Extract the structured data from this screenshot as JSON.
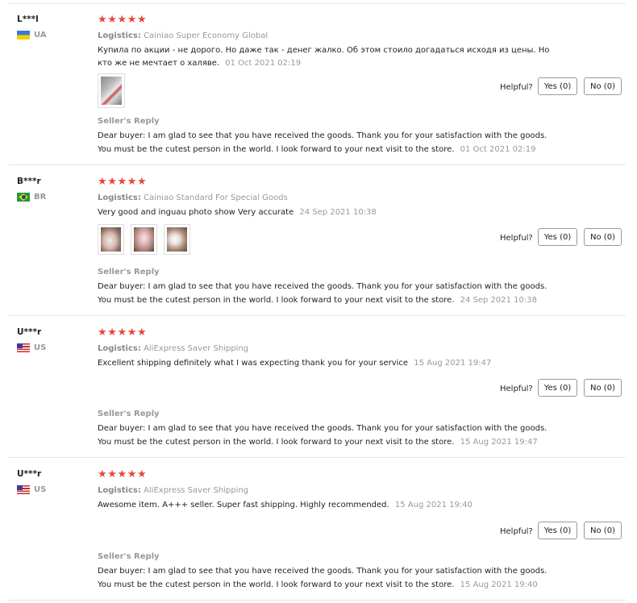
{
  "labels": {
    "logistics": "Logistics:",
    "helpful": "Helpful?",
    "sellers_reply": "Seller's Reply"
  },
  "reviews": [
    {
      "user": "L***l",
      "country": "UA",
      "stars": "★★★★★",
      "logistics": "Cainiao Super Economy Global",
      "text": "Купила по акции - не дорого. Но даже так - денег жалко. Об этом стоило догадаться исходя из цены. Но кто же не мечтает о халяве.",
      "date": "01 Oct 2021 02:19",
      "yes": "Yes (0)",
      "no": "No (0)",
      "reply_line1": "Dear buyer: I am glad to see that you have received the goods. Thank you for your satisfaction with the goods.",
      "reply_line2": "You must be the cutest person in the world. I look forward to your next visit to the store.",
      "reply_date": "01 Oct 2021 02:19"
    },
    {
      "user": "B***r",
      "country": "BR",
      "stars": "★★★★★",
      "logistics": "Cainiao Standard For Special Goods",
      "text": "Very good and inguau photo show Very accurate",
      "date": "24 Sep 2021 10:38",
      "yes": "Yes (0)",
      "no": "No (0)",
      "reply_line1": "Dear buyer: I am glad to see that you have received the goods. Thank you for your satisfaction with the goods.",
      "reply_line2": "You must be the cutest person in the world. I look forward to your next visit to the store.",
      "reply_date": "24 Sep 2021 10:38"
    },
    {
      "user": "U***r",
      "country": "US",
      "stars": "★★★★★",
      "logistics": "AliExpress Saver Shipping",
      "text": "Excellent shipping definitely what I was expecting thank you for your service",
      "date": "15 Aug 2021 19:47",
      "yes": "Yes (0)",
      "no": "No (0)",
      "reply_line1": "Dear buyer: I am glad to see that you have received the goods. Thank you for your satisfaction with the goods.",
      "reply_line2": "You must be the cutest person in the world. I look forward to your next visit to the store.",
      "reply_date": "15 Aug 2021 19:47"
    },
    {
      "user": "U***r",
      "country": "US",
      "stars": "★★★★★",
      "logistics": "AliExpress Saver Shipping",
      "text": "Awesome item. A+++ seller. Super fast shipping. Highly recommended.",
      "date": "15 Aug 2021 19:40",
      "yes": "Yes (0)",
      "no": "No (0)",
      "reply_line1": "Dear buyer: I am glad to see that you have received the goods. Thank you for your satisfaction with the goods.",
      "reply_line2": "You must be the cutest person in the world. I look forward to your next visit to the store.",
      "reply_date": "15 Aug 2021 19:40"
    }
  ],
  "colors": {
    "star": "#e8453c",
    "muted": "#999999",
    "divider": "#e6e6e6"
  }
}
